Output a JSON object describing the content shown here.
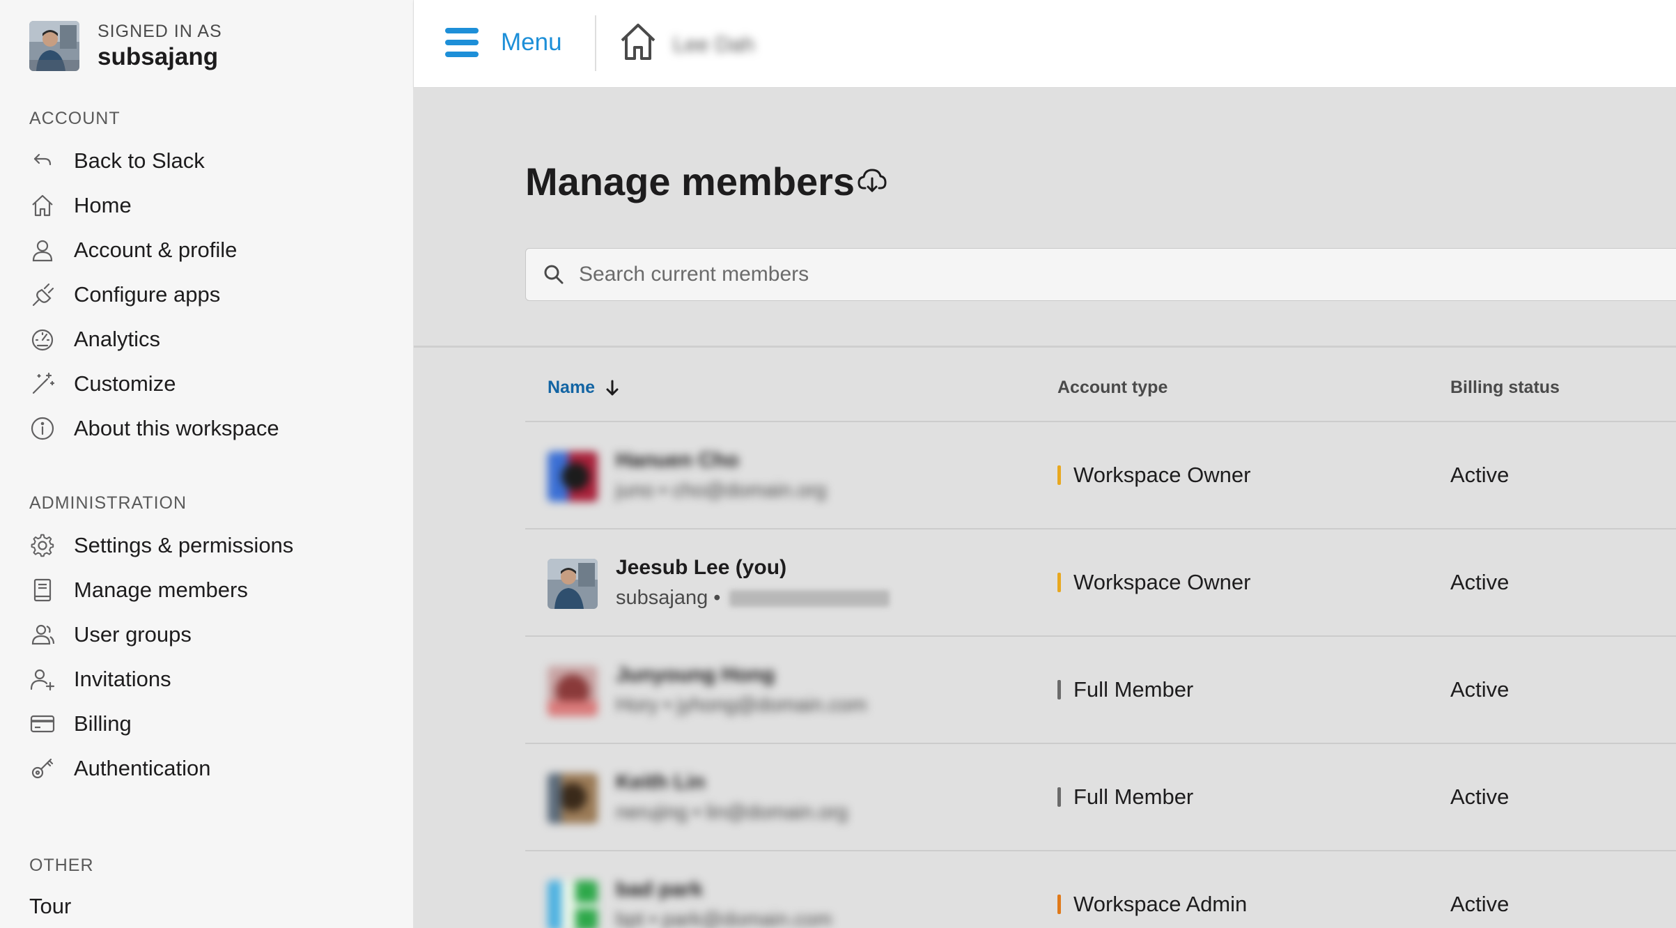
{
  "sidebar": {
    "signed_in_label": "SIGNED IN AS",
    "username": "subsajang",
    "account_section": "ACCOUNT",
    "account_items": [
      {
        "label": "Back to Slack",
        "icon": "back-arrow-icon"
      },
      {
        "label": "Home",
        "icon": "home-icon"
      },
      {
        "label": "Account & profile",
        "icon": "person-icon"
      },
      {
        "label": "Configure apps",
        "icon": "plug-icon"
      },
      {
        "label": "Analytics",
        "icon": "gauge-icon"
      },
      {
        "label": "Customize",
        "icon": "magic-wand-icon"
      },
      {
        "label": "About this workspace",
        "icon": "info-icon"
      }
    ],
    "admin_section": "ADMINISTRATION",
    "admin_items": [
      {
        "label": "Settings & permissions",
        "icon": "gear-icon"
      },
      {
        "label": "Manage members",
        "icon": "members-book-icon"
      },
      {
        "label": "User groups",
        "icon": "user-group-icon"
      },
      {
        "label": "Invitations",
        "icon": "add-person-icon"
      },
      {
        "label": "Billing",
        "icon": "credit-card-icon"
      },
      {
        "label": "Authentication",
        "icon": "key-icon"
      }
    ],
    "other_section": "OTHER",
    "tour_label": "Tour"
  },
  "topbar": {
    "menu_label": "Menu",
    "workspace_name": "Lee Dah"
  },
  "main": {
    "title": "Manage members",
    "search_placeholder": "Search current members",
    "columns": {
      "name": "Name",
      "account_type": "Account type",
      "billing_status": "Billing status"
    },
    "members": [
      {
        "name": "Hanuen Cho",
        "handle": "juno",
        "email": "cho@domain.org",
        "account_type": "Workspace Owner",
        "type_color": "#e8a820",
        "billing": "Active",
        "blurred": true
      },
      {
        "name": "Jeesub Lee (you)",
        "handle": "subsajang",
        "account_type": "Workspace Owner",
        "type_color": "#e8a820",
        "billing": "Active",
        "blurred": false
      },
      {
        "name": "Junyoung Hong",
        "handle": "Hory",
        "email": "jyhong@domain.com",
        "account_type": "Full Member",
        "type_color": "#6b6b6b",
        "billing": "Active",
        "blurred": true
      },
      {
        "name": "Keith Lin",
        "handle": "nerujing",
        "email": "lin@domain.org",
        "account_type": "Full Member",
        "type_color": "#6b6b6b",
        "billing": "Active",
        "blurred": true
      },
      {
        "name": "bad park",
        "handle": "bpt",
        "email": "park@domain.com",
        "account_type": "Workspace Admin",
        "type_color": "#e07a1a",
        "billing": "Active",
        "blurred": true
      }
    ]
  },
  "colors": {
    "accent": "#1d8fd8",
    "link": "#1264a3",
    "owner": "#e8a820",
    "admin": "#e07a1a",
    "member": "#6b6b6b"
  }
}
